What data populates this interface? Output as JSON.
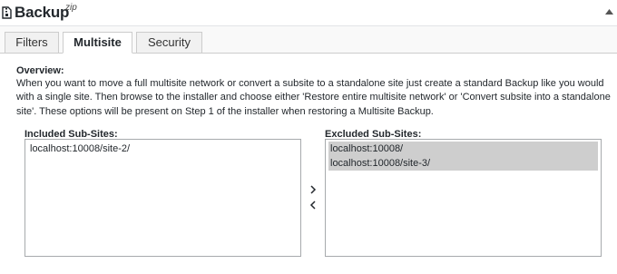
{
  "header": {
    "title": "Backup",
    "title_sup": "zip",
    "icon": "archive-icon",
    "collapse_icon": "caret-up-icon"
  },
  "tabs": [
    {
      "label": "Filters",
      "active": false
    },
    {
      "label": "Multisite",
      "active": true
    },
    {
      "label": "Security",
      "active": false
    }
  ],
  "overview": {
    "title": "Overview:",
    "text": "When you want to move a full multisite network or convert a subsite to a standalone site just create a standard Backup like you would with a single site. Then browse to the installer and choose either 'Restore entire multisite network' or 'Convert subsite into a standalone site'. These options will be present on Step 1 of the installer when restoring a Multisite Backup."
  },
  "included": {
    "label": "Included Sub-Sites:",
    "items": [
      {
        "text": "localhost:10008/site-2/",
        "selected": false
      }
    ]
  },
  "excluded": {
    "label": "Excluded Sub-Sites:",
    "items": [
      {
        "text": "localhost:10008/",
        "selected": true
      },
      {
        "text": "localhost:10008/site-3/",
        "selected": true
      }
    ]
  },
  "controls": {
    "move_right_icon": "chevron-right-icon",
    "move_left_icon": "chevron-left-icon"
  },
  "colors": {
    "selected_bg": "#cecece",
    "border": "#cccccc"
  }
}
